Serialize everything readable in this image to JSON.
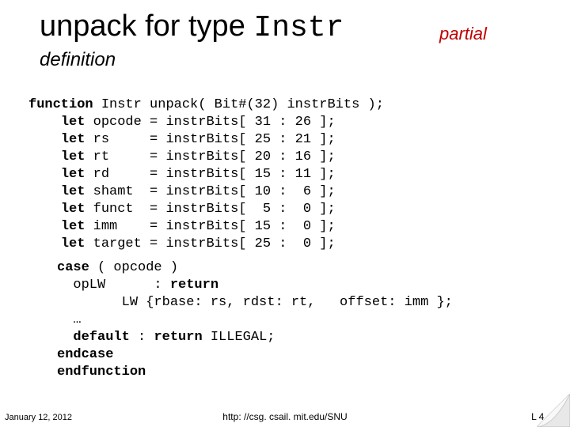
{
  "title": {
    "prefix": "unpack for type ",
    "mono": "Instr",
    "tag": "partial",
    "subtitle": "definition"
  },
  "decl": {
    "kw_function": "function",
    "type": " Instr ",
    "sig": "unpack( Bit#(32) instrBits );",
    "lets": [
      {
        "kw": "let",
        "name": "opcode",
        "expr": "= instrBits[ 31 : 26 ];"
      },
      {
        "kw": "let",
        "name": "rs    ",
        "expr": "= instrBits[ 25 : 21 ];"
      },
      {
        "kw": "let",
        "name": "rt    ",
        "expr": "= instrBits[ 20 : 16 ];"
      },
      {
        "kw": "let",
        "name": "rd    ",
        "expr": "= instrBits[ 15 : 11 ];"
      },
      {
        "kw": "let",
        "name": "shamt ",
        "expr": "= instrBits[ 10 :  6 ];"
      },
      {
        "kw": "let",
        "name": "funct ",
        "expr": "= instrBits[  5 :  0 ];"
      },
      {
        "kw": "let",
        "name": "imm   ",
        "expr": "= instrBits[ 15 :  0 ];"
      },
      {
        "kw": "let",
        "name": "target",
        "expr": "= instrBits[ 25 :  0 ];"
      }
    ]
  },
  "body": {
    "l1a": "case",
    "l1b": " ( opcode )",
    "l2a": "  opLW      : ",
    "l2b": "return",
    "l3": "        LW {rbase: rs, rdst: rt,   offset: imm };",
    "l4": "  …",
    "l5a": "  default",
    "l5b": " : ",
    "l5c": "return",
    "l5d": " ILLEGAL;",
    "l6": "endcase",
    "l7": "endfunction"
  },
  "footer": {
    "date": "January 12, 2012",
    "url": "http: //csg. csail. mit.edu/SNU",
    "page": "L 4 -21"
  }
}
